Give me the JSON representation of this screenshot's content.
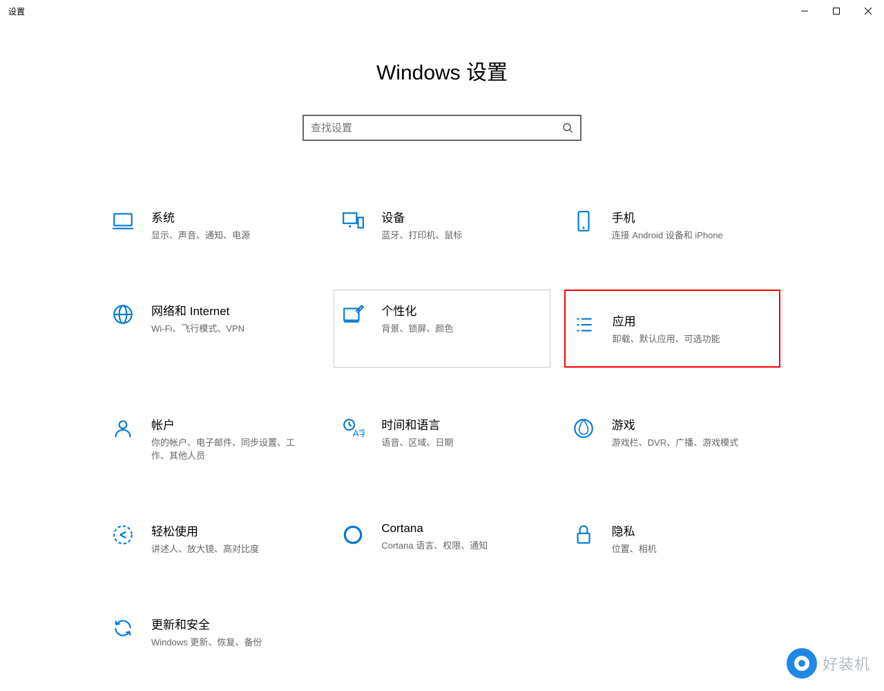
{
  "window": {
    "title": "设置"
  },
  "header": {
    "title": "Windows 设置"
  },
  "search": {
    "placeholder": "查找设置"
  },
  "categories": [
    {
      "title": "系统",
      "desc": "显示、声音、通知、电源",
      "icon": "laptop"
    },
    {
      "title": "设备",
      "desc": "蓝牙、打印机、鼠标",
      "icon": "devices"
    },
    {
      "title": "手机",
      "desc": "连接 Android 设备和 iPhone",
      "icon": "phone"
    },
    {
      "title": "网络和 Internet",
      "desc": "Wi-Fi、飞行模式、VPN",
      "icon": "globe"
    },
    {
      "title": "个性化",
      "desc": "背景、锁屏、颜色",
      "icon": "personalize"
    },
    {
      "title": "应用",
      "desc": "卸载、默认应用、可选功能",
      "icon": "apps"
    },
    {
      "title": "帐户",
      "desc": "你的帐户、电子邮件、同步设置、工作、其他人员",
      "icon": "account"
    },
    {
      "title": "时间和语言",
      "desc": "语音、区域、日期",
      "icon": "time-lang"
    },
    {
      "title": "游戏",
      "desc": "游戏栏、DVR、广播、游戏模式",
      "icon": "gaming"
    },
    {
      "title": "轻松使用",
      "desc": "讲述人、放大镜、高对比度",
      "icon": "ease"
    },
    {
      "title": "Cortana",
      "desc": "Cortana 语言、权限、通知",
      "icon": "cortana"
    },
    {
      "title": "隐私",
      "desc": "位置、相机",
      "icon": "privacy"
    },
    {
      "title": "更新和安全",
      "desc": "Windows 更新、恢复、备份",
      "icon": "update"
    }
  ],
  "watermark": {
    "text": "好装机"
  }
}
